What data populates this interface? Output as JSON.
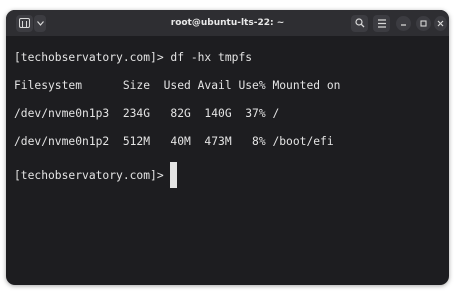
{
  "window": {
    "title": "root@ubuntu-lts-22: ~",
    "buttons": {
      "new_tab_icon": "terminal-tab-icon",
      "search_icon": "search-icon",
      "menu_icon": "hamburger-menu-icon",
      "minimize_icon": "minimize-icon",
      "maximize_icon": "maximize-icon",
      "close_icon": "close-icon"
    }
  },
  "terminal": {
    "lines": [
      "[techobservatory.com]> df -hx tmpfs",
      "Filesystem      Size  Used Avail Use% Mounted on",
      "/dev/nvme0n1p3  234G   82G  140G  37% /",
      "/dev/nvme0n1p2  512M   40M  473M   8% /boot/efi",
      "[techobservatory.com]> "
    ]
  },
  "colors": {
    "terminal_bg": "#1d1d20",
    "titlebar_bg": "#2e2e32",
    "text": "#e4e4e4"
  }
}
